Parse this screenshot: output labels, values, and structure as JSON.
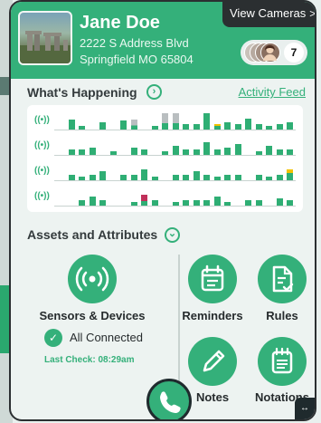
{
  "header": {
    "name": "Jane Doe",
    "address_line1": "2222 S Address Blvd",
    "address_line2": "Springfield MO 65804",
    "view_cameras_label": "View Cameras",
    "avatar_count": "7",
    "accent_color": "#34b07a"
  },
  "activity": {
    "title": "What's Happening",
    "link_label": "Activity Feed",
    "row_icon": "((•))",
    "rows": [
      {
        "bars": [
          [
            "g",
            0
          ],
          [
            "g",
            0.55
          ],
          [
            "g",
            0.2
          ],
          [
            "g",
            0
          ],
          [
            "g",
            0.4
          ],
          [
            "g",
            0
          ],
          [
            "g",
            0.5
          ],
          [
            "gr",
            0.55
          ],
          [
            "g",
            0
          ],
          [
            "g",
            0.2
          ],
          [
            "gr",
            0.9
          ],
          [
            "gr",
            0.9
          ],
          [
            "g",
            0.3
          ],
          [
            "g",
            0.3
          ],
          [
            "g",
            0.9
          ],
          [
            "y",
            0.3
          ],
          [
            "g",
            0.4
          ],
          [
            "g",
            0.3
          ],
          [
            "g",
            0.6
          ],
          [
            "g",
            0.3
          ],
          [
            "g",
            0.2
          ],
          [
            "g",
            0.3
          ],
          [
            "g",
            0.4
          ]
        ]
      },
      {
        "bars": [
          [
            "g",
            0
          ],
          [
            "g",
            0.3
          ],
          [
            "g",
            0.3
          ],
          [
            "g",
            0.4
          ],
          [
            "g",
            0
          ],
          [
            "g",
            0.2
          ],
          [
            "g",
            0
          ],
          [
            "g",
            0.4
          ],
          [
            "g",
            0.3
          ],
          [
            "g",
            0
          ],
          [
            "g",
            0.2
          ],
          [
            "g",
            0.5
          ],
          [
            "g",
            0.3
          ],
          [
            "g",
            0.3
          ],
          [
            "g",
            0.7
          ],
          [
            "g",
            0.3
          ],
          [
            "g",
            0.4
          ],
          [
            "g",
            0.6
          ],
          [
            "g",
            0
          ],
          [
            "g",
            0.2
          ],
          [
            "g",
            0.5
          ],
          [
            "g",
            0.3
          ],
          [
            "g",
            0.3
          ]
        ]
      },
      {
        "bars": [
          [
            "g",
            0
          ],
          [
            "g",
            0.3
          ],
          [
            "g",
            0.2
          ],
          [
            "g",
            0.3
          ],
          [
            "g",
            0.5
          ],
          [
            "g",
            0
          ],
          [
            "g",
            0.3
          ],
          [
            "g",
            0.3
          ],
          [
            "g",
            0.6
          ],
          [
            "g",
            0.2
          ],
          [
            "g",
            0
          ],
          [
            "g",
            0.3
          ],
          [
            "g",
            0.3
          ],
          [
            "g",
            0.5
          ],
          [
            "g",
            0.3
          ],
          [
            "g",
            0.2
          ],
          [
            "g",
            0.3
          ],
          [
            "g",
            0.3
          ],
          [
            "g",
            0
          ],
          [
            "g",
            0.3
          ],
          [
            "g",
            0.2
          ],
          [
            "g",
            0.3
          ],
          [
            "y",
            0.6
          ]
        ]
      },
      {
        "bars": [
          [
            "g",
            0
          ],
          [
            "g",
            0
          ],
          [
            "g",
            0.3
          ],
          [
            "g",
            0.5
          ],
          [
            "g",
            0.3
          ],
          [
            "g",
            0
          ],
          [
            "g",
            0
          ],
          [
            "g",
            0.2
          ],
          [
            "pk",
            0.6
          ],
          [
            "g",
            0.3
          ],
          [
            "g",
            0
          ],
          [
            "g",
            0.2
          ],
          [
            "g",
            0.3
          ],
          [
            "g",
            0.3
          ],
          [
            "g",
            0.3
          ],
          [
            "g",
            0.5
          ],
          [
            "g",
            0.2
          ],
          [
            "g",
            0
          ],
          [
            "g",
            0.3
          ],
          [
            "g",
            0.3
          ],
          [
            "g",
            0
          ],
          [
            "g",
            0.4
          ],
          [
            "g",
            0.3
          ]
        ]
      }
    ],
    "colors": {
      "g": "#2fae74",
      "gr": "#b9bec0",
      "y": "#f2c200",
      "pk": "#c0305a"
    }
  },
  "assets": {
    "title": "Assets and Attributes",
    "sensors_label": "Sensors & Devices",
    "connected_label": "All Connected",
    "last_check": "Last Check: 08:29am",
    "reminders_label": "Reminders",
    "rules_label": "Rules",
    "notes_label": "Notes",
    "notations_label": "Notations"
  }
}
